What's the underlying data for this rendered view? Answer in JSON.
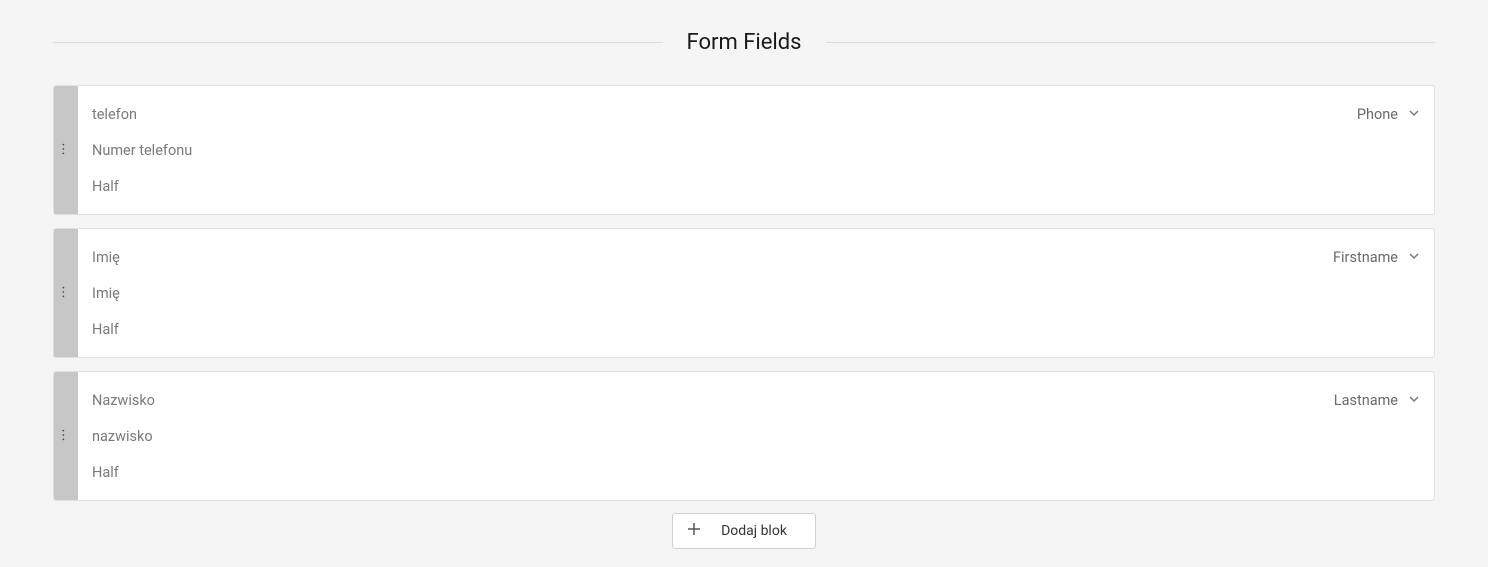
{
  "section_title": "Form Fields",
  "fields": [
    {
      "name": "telefon",
      "placeholder": "Numer telefonu",
      "width": "Half",
      "type": "Phone"
    },
    {
      "name": "Imię",
      "placeholder": "Imię",
      "width": "Half",
      "type": "Firstname"
    },
    {
      "name": "Nazwisko",
      "placeholder": "nazwisko",
      "width": "Half",
      "type": "Lastname"
    }
  ],
  "add_block_label": "Dodaj blok"
}
